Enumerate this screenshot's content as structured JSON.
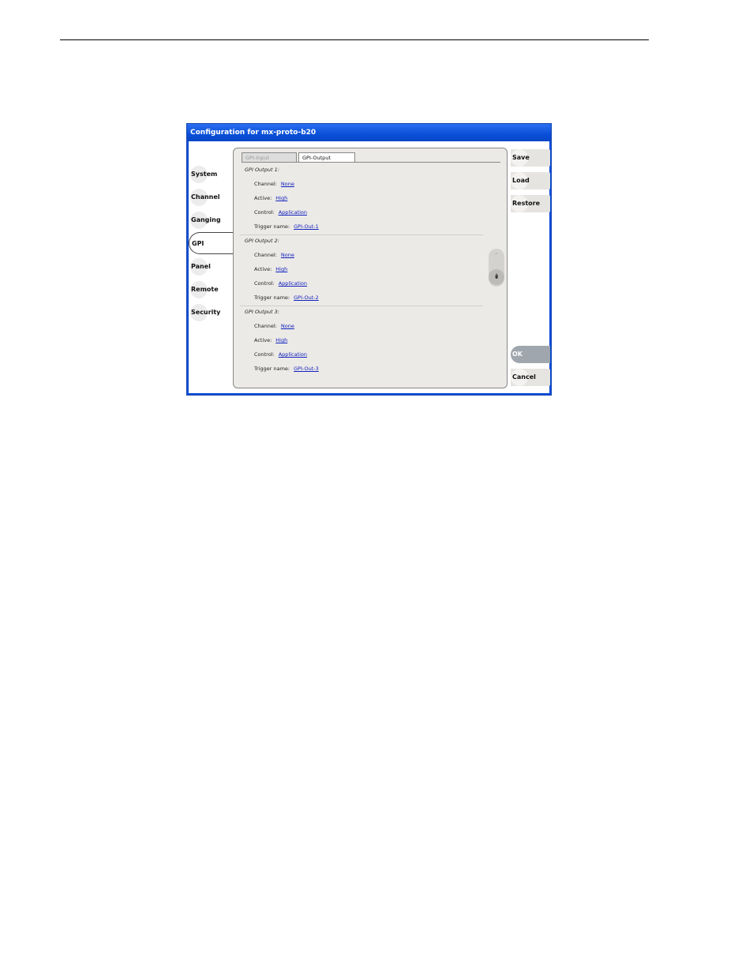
{
  "window": {
    "title": "Configuration for mx-proto-b20"
  },
  "nav": {
    "items": [
      {
        "id": "system",
        "label": "System"
      },
      {
        "id": "channel",
        "label": "Channel"
      },
      {
        "id": "ganging",
        "label": "Ganging"
      },
      {
        "id": "gpi",
        "label": "GPI",
        "selected": true
      },
      {
        "id": "panel",
        "label": "Panel"
      },
      {
        "id": "remote",
        "label": "Remote"
      },
      {
        "id": "security",
        "label": "Security"
      }
    ]
  },
  "tabs": [
    {
      "id": "gpi-input",
      "label": "GPI-Input",
      "selected": false
    },
    {
      "id": "gpi-output",
      "label": "GPI-Output",
      "selected": true
    }
  ],
  "outputs": [
    {
      "title": "GPI Output 1:",
      "channel_label": "Channel:",
      "channel_value": "None",
      "active_label": "Active:",
      "active_value": "High",
      "control_label": "Control:",
      "control_value": "Application",
      "trigger_label": "Trigger name:",
      "trigger_value": "GPI-Out-1"
    },
    {
      "title": "GPI Output 2:",
      "channel_label": "Channel:",
      "channel_value": "None",
      "active_label": "Active:",
      "active_value": "High",
      "control_label": "Control:",
      "control_value": "Application",
      "trigger_label": "Trigger name:",
      "trigger_value": "GPI-Out-2"
    },
    {
      "title": "GPI Output 3:",
      "channel_label": "Channel:",
      "channel_value": "None",
      "active_label": "Active:",
      "active_value": "High",
      "control_label": "Control:",
      "control_value": "Application",
      "trigger_label": "Trigger name:",
      "trigger_value": "GPI-Out-3"
    }
  ],
  "scroll": {
    "up_icon": "chevron-up",
    "down_icon": "double-chevron-down"
  },
  "actions": {
    "save": "Save",
    "load": "Load",
    "restore": "Restore",
    "ok": "OK",
    "cancel": "Cancel"
  },
  "colors": {
    "title_bar": "#0a4fd8",
    "link": "#1020c0",
    "ok_button": "#9fa6ae"
  }
}
